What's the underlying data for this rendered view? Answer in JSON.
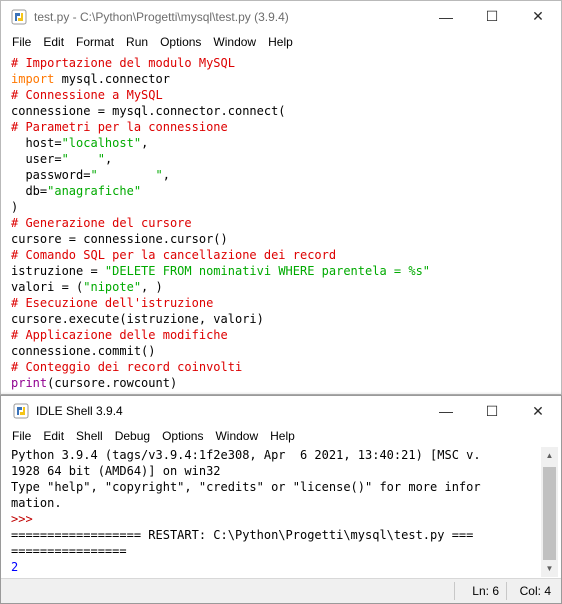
{
  "editor": {
    "title": "test.py - C:\\Python\\Progetti\\mysql\\test.py (3.9.4)",
    "menu": [
      "File",
      "Edit",
      "Format",
      "Run",
      "Options",
      "Window",
      "Help"
    ],
    "window_buttons": {
      "minimize": "—",
      "maximize": "☐",
      "close": "✕"
    },
    "code_lines": [
      [
        {
          "t": "# Importazione del modulo MySQL",
          "c": "comment"
        }
      ],
      [
        {
          "t": "import",
          "c": "kw"
        },
        {
          "t": " mysql.connector",
          "c": ""
        }
      ],
      [
        {
          "t": "# Connessione a MySQL",
          "c": "comment"
        }
      ],
      [
        {
          "t": "connessione = mysql.connector.connect(",
          "c": ""
        }
      ],
      [
        {
          "t": "# Parametri per la connessione",
          "c": "comment"
        }
      ],
      [
        {
          "t": "  host=",
          "c": ""
        },
        {
          "t": "\"localhost\"",
          "c": "str"
        },
        {
          "t": ",",
          "c": ""
        }
      ],
      [
        {
          "t": "  user=",
          "c": ""
        },
        {
          "t": "\"    \"",
          "c": "str"
        },
        {
          "t": ",",
          "c": ""
        }
      ],
      [
        {
          "t": "  password=",
          "c": ""
        },
        {
          "t": "\"        \"",
          "c": "str"
        },
        {
          "t": ",",
          "c": ""
        }
      ],
      [
        {
          "t": "  db=",
          "c": ""
        },
        {
          "t": "\"anagrafiche\"",
          "c": "str"
        }
      ],
      [
        {
          "t": ")",
          "c": ""
        }
      ],
      [
        {
          "t": "# Generazione del cursore",
          "c": "comment"
        }
      ],
      [
        {
          "t": "cursore = connessione.cursor()",
          "c": ""
        }
      ],
      [
        {
          "t": "# Comando SQL per la cancellazione dei record",
          "c": "comment"
        }
      ],
      [
        {
          "t": "istruzione = ",
          "c": ""
        },
        {
          "t": "\"DELETE FROM nominativi WHERE parentela = %s\"",
          "c": "str"
        }
      ],
      [
        {
          "t": "valori = (",
          "c": ""
        },
        {
          "t": "\"nipote\"",
          "c": "str"
        },
        {
          "t": ", )",
          "c": ""
        }
      ],
      [
        {
          "t": "# Esecuzione dell'istruzione",
          "c": "comment"
        }
      ],
      [
        {
          "t": "cursore.execute(istruzione, valori)",
          "c": ""
        }
      ],
      [
        {
          "t": "# Applicazione delle modifiche",
          "c": "comment"
        }
      ],
      [
        {
          "t": "connessione.commit()",
          "c": ""
        }
      ],
      [
        {
          "t": "# Conteggio dei record coinvolti",
          "c": "comment"
        }
      ],
      [
        {
          "t": "print",
          "c": "builtin"
        },
        {
          "t": "(cursore.rowcount)",
          "c": ""
        }
      ]
    ]
  },
  "shell": {
    "title": "IDLE Shell 3.9.4",
    "menu": [
      "File",
      "Edit",
      "Shell",
      "Debug",
      "Options",
      "Window",
      "Help"
    ],
    "window_buttons": {
      "minimize": "—",
      "maximize": "☐",
      "close": "✕"
    },
    "lines": [
      [
        {
          "t": "Python 3.9.4 (tags/v3.9.4:1f2e308, Apr  6 2021, 13:40:21) [MSC v.",
          "c": ""
        }
      ],
      [
        {
          "t": "1928 64 bit (AMD64)] on win32",
          "c": ""
        }
      ],
      [
        {
          "t": "Type \"help\", \"copyright\", \"credits\" or \"license()\" for more infor",
          "c": ""
        }
      ],
      [
        {
          "t": "mation.",
          "c": ""
        }
      ],
      [
        {
          "t": ">>>",
          "c": "prompt"
        }
      ],
      [
        {
          "t": "================== RESTART: C:\\Python\\Progetti\\mysql\\test.py ===",
          "c": ""
        }
      ],
      [
        {
          "t": "================",
          "c": ""
        }
      ],
      [
        {
          "t": "2",
          "c": "out"
        }
      ],
      [
        {
          "t": "   .",
          "c": ""
        }
      ]
    ],
    "status": {
      "line": "Ln: 6",
      "col": "Col: 4"
    }
  }
}
